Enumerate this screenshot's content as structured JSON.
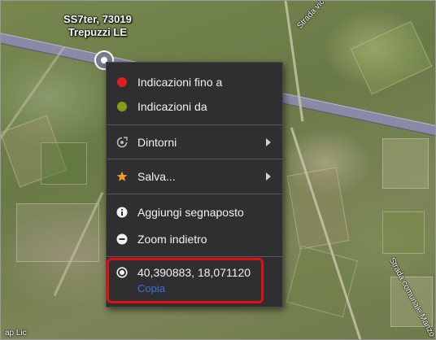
{
  "map": {
    "place_label_line1": "SS7ter, 73019",
    "place_label_line2": "Trepuzzi LE",
    "road_label_top": "Strada vic",
    "road_label_right": "Strada comunale Manzo",
    "road_label_bottom": "ap Lic"
  },
  "context_menu": {
    "items": [
      {
        "label": "Indicazioni fino a",
        "icon": "red-circle-icon",
        "color": "#e02020"
      },
      {
        "label": "Indicazioni da",
        "icon": "green-circle-icon",
        "color": "#8a9a1a"
      },
      {
        "label": "Dintorni",
        "icon": "nearby-icon",
        "has_submenu": true
      },
      {
        "label": "Salva...",
        "icon": "star-icon",
        "color": "#f0a020",
        "has_submenu": true
      },
      {
        "label": "Aggiungi segnaposto",
        "icon": "info-icon"
      },
      {
        "label": "Zoom indietro",
        "icon": "minus-circle-icon"
      }
    ],
    "coordinates": "40,390883, 18,071120",
    "copy_label": "Copia"
  },
  "colors": {
    "menu_bg": "#2f2f31",
    "highlight": "#e01010",
    "link": "#3a6fd8"
  }
}
